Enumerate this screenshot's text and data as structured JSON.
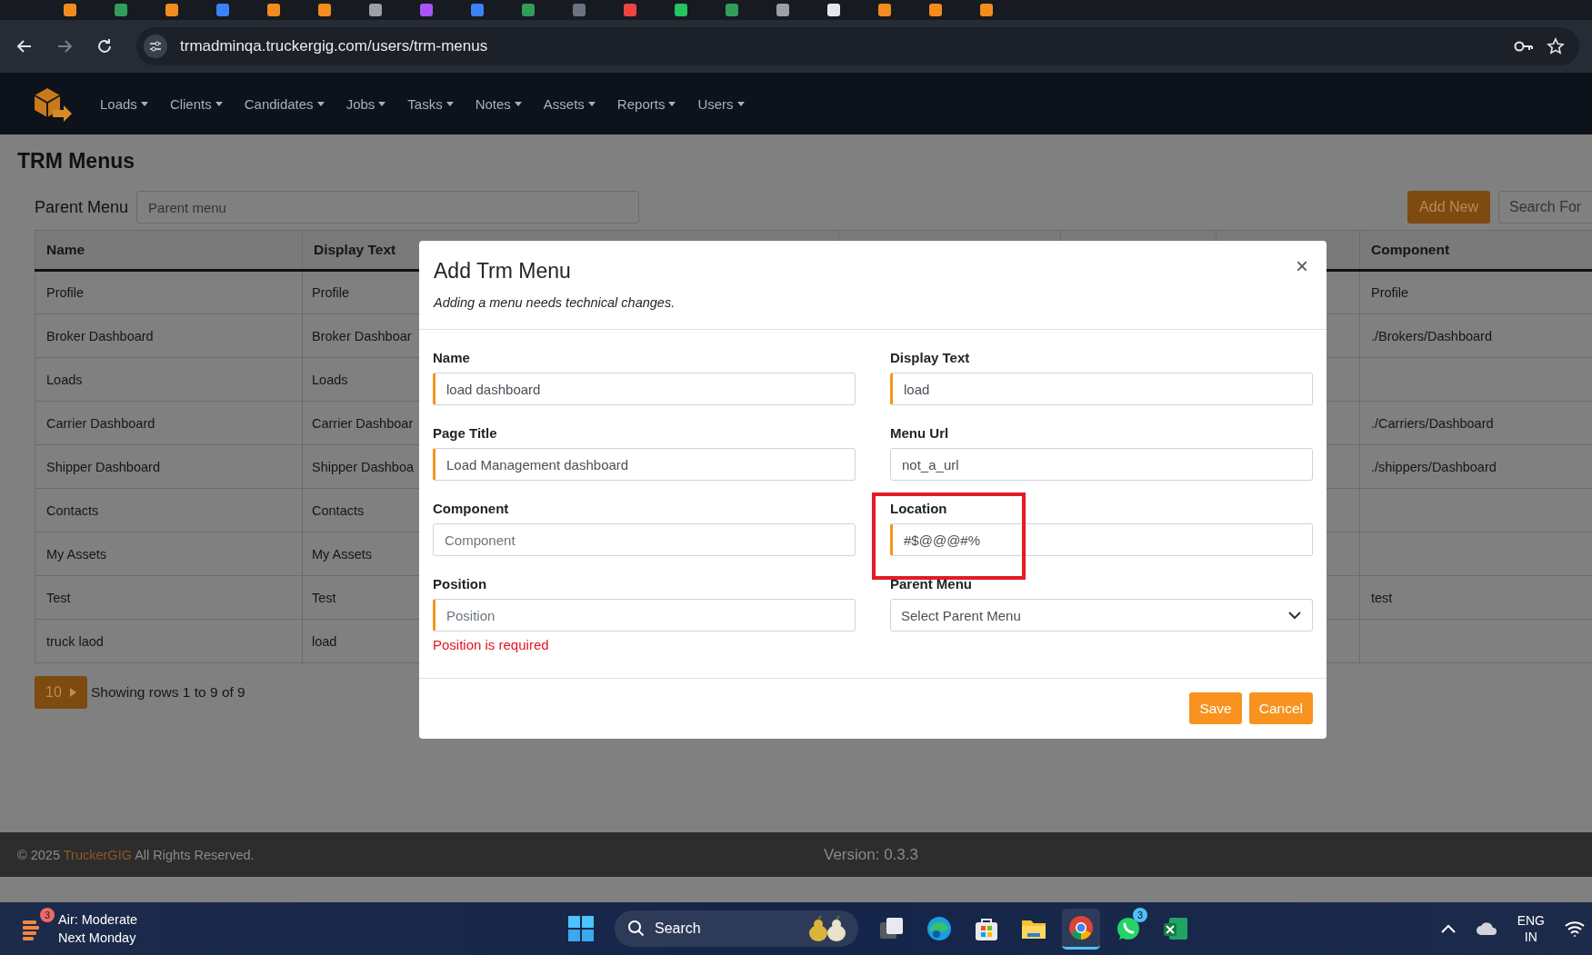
{
  "browser": {
    "url": "trmadminqa.truckergig.com/users/trm-menus"
  },
  "nav": {
    "items": [
      "Loads",
      "Clients",
      "Candidates",
      "Jobs",
      "Tasks",
      "Notes",
      "Assets",
      "Reports",
      "Users"
    ]
  },
  "page": {
    "title": "TRM Menus",
    "parent_menu_label": "Parent Menu",
    "parent_menu_placeholder": "Parent menu",
    "add_button": "Add New",
    "search_placeholder": "Search For"
  },
  "table": {
    "columns": [
      "Name",
      "Display Text",
      "Component"
    ],
    "rows": [
      {
        "name": "Profile",
        "display_text": "Profile",
        "component": "Profile"
      },
      {
        "name": "Broker Dashboard",
        "display_text": "Broker Dashboar",
        "component": "./Brokers/Dashboard"
      },
      {
        "name": "Loads",
        "display_text": "Loads"
      },
      {
        "name": "Carrier Dashboard",
        "display_text": "Carrier Dashboar",
        "component": "./Carriers/Dashboard"
      },
      {
        "name": "Shipper Dashboard",
        "display_text": "Shipper Dashboa",
        "component": "./shippers/Dashboard"
      },
      {
        "name": "Contacts",
        "display_text": "Contacts"
      },
      {
        "name": "My Assets",
        "display_text": "My Assets"
      },
      {
        "name": "Test",
        "display_text": "Test",
        "component": "test"
      },
      {
        "name": "truck laod",
        "display_text": "load"
      }
    ]
  },
  "pagination": {
    "page_size": "10",
    "summary": "Showing rows 1 to 9 of 9"
  },
  "modal": {
    "title": "Add Trm Menu",
    "subtitle": "Adding a menu needs technical changes.",
    "close": "×",
    "fields": [
      {
        "label": "Name",
        "kind": "text",
        "value": "load dashboard",
        "required": true,
        "highlighted": false
      },
      {
        "label": "Display Text",
        "kind": "text",
        "value": "load",
        "required": true,
        "highlighted": false
      },
      {
        "label": "Page Title",
        "kind": "text",
        "value": "Load Management dashboard",
        "required": true,
        "highlighted": false
      },
      {
        "label": "Menu Url",
        "kind": "text",
        "value": "not_a_url",
        "required": false,
        "highlighted": false
      },
      {
        "label": "Component",
        "kind": "text",
        "placeholder": "Component",
        "required": false,
        "highlighted": false
      },
      {
        "label": "Location",
        "kind": "text",
        "value": "#$@@@#%",
        "required": true,
        "highlighted": true
      },
      {
        "label": "Position",
        "kind": "text",
        "placeholder": "Position",
        "required": true,
        "highlighted": false,
        "error": "Position is required"
      },
      {
        "label": "Parent Menu",
        "kind": "select",
        "value": "Select Parent Menu",
        "required": false,
        "highlighted": false
      }
    ],
    "buttons": [
      "Save",
      "Cancel"
    ]
  },
  "footer": {
    "copyright": "© 2025",
    "brand": "TruckerGIG",
    "rights": "All Rights Reserved.",
    "version": "Version: 0.3.3"
  },
  "taskbar": {
    "weather": {
      "badge": "3",
      "title": "Air: Moderate",
      "subtitle": "Next Monday"
    },
    "search": "Search",
    "whatsapp_badge": "3",
    "language": "ENG",
    "region": "IN"
  }
}
